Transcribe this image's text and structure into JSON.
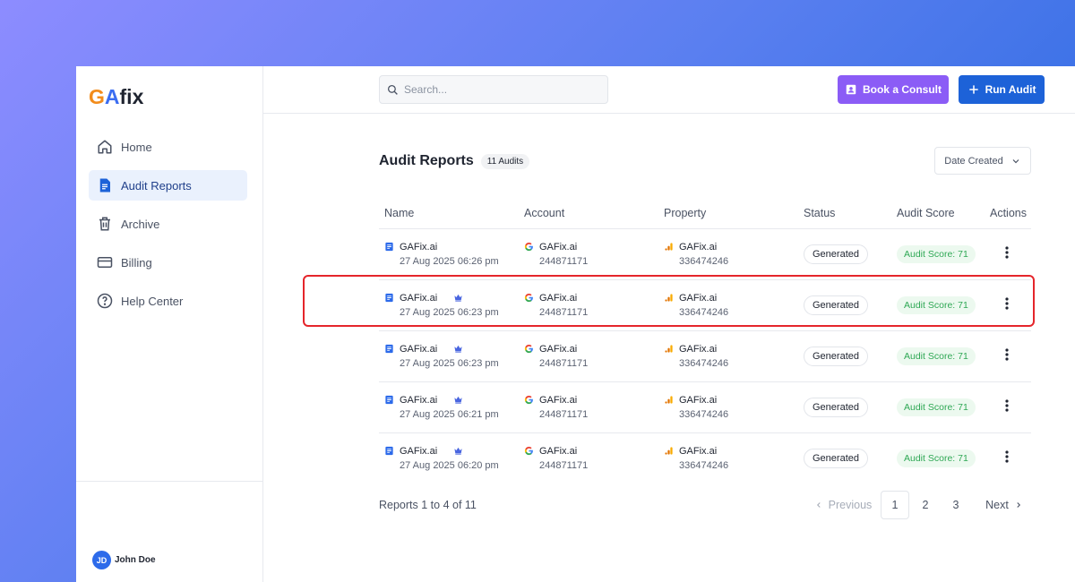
{
  "brand": {
    "g": "G",
    "a": "A",
    "fix": "fix"
  },
  "sidebar": {
    "items": [
      {
        "label": "Home",
        "icon": "home-icon"
      },
      {
        "label": "Audit Reports",
        "icon": "document-icon"
      },
      {
        "label": "Archive",
        "icon": "trash-icon"
      },
      {
        "label": "Billing",
        "icon": "credit-card-icon"
      },
      {
        "label": "Help Center",
        "icon": "help-circle-icon"
      }
    ],
    "active_index": 1
  },
  "user": {
    "initials": "JD",
    "name": "John Doe"
  },
  "topbar": {
    "search_placeholder": "Search...",
    "consult_label": "Book a Consult",
    "run_label": "Run Audit"
  },
  "page": {
    "title": "Audit Reports",
    "count_badge": "11 Audits",
    "sort_label": "Date Created"
  },
  "table": {
    "headers": [
      "Name",
      "Account",
      "Property",
      "Status",
      "Audit Score",
      "Actions"
    ],
    "rows": [
      {
        "name": "GAFix.ai",
        "date": "27 Aug 2025 06:26 pm",
        "account": "GAFix.ai",
        "account_id": "244871171",
        "property": "GAFix.ai",
        "property_id": "336474246",
        "status": "Generated",
        "score": "Audit Score: 71"
      },
      {
        "name": "GAFix.ai",
        "date": "27 Aug 2025 06:23 pm",
        "account": "GAFix.ai",
        "account_id": "244871171",
        "property": "GAFix.ai",
        "property_id": "336474246",
        "status": "Generated",
        "score": "Audit Score: 71"
      },
      {
        "name": "GAFix.ai",
        "date": "27 Aug 2025 06:23 pm",
        "account": "GAFix.ai",
        "account_id": "244871171",
        "property": "GAFix.ai",
        "property_id": "336474246",
        "status": "Generated",
        "score": "Audit Score: 71"
      },
      {
        "name": "GAFix.ai",
        "date": "27 Aug 2025 06:21 pm",
        "account": "GAFix.ai",
        "account_id": "244871171",
        "property": "GAFix.ai",
        "property_id": "336474246",
        "status": "Generated",
        "score": "Audit Score: 71"
      },
      {
        "name": "GAFix.ai",
        "date": "27 Aug 2025 06:20 pm",
        "account": "GAFix.ai",
        "account_id": "244871171",
        "property": "GAFix.ai",
        "property_id": "336474246",
        "status": "Generated",
        "score": "Audit Score: 71"
      }
    ]
  },
  "pagination": {
    "summary": "Reports 1 to 4 of 11",
    "previous": "Previous",
    "pages": [
      "1",
      "2",
      "3"
    ],
    "current": "1",
    "next": "Next"
  },
  "colors": {
    "accent": "#1d62d8",
    "consult": "#8b5cf6",
    "score_text": "#2fa855",
    "highlight": "#e5252b"
  }
}
